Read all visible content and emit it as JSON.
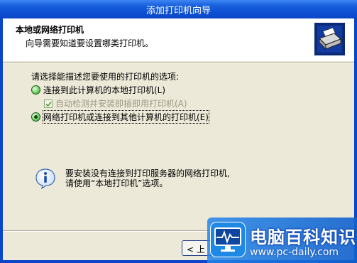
{
  "window": {
    "title": "添加打印机向导",
    "colors": {
      "titlebar": "#0c4fd3",
      "client": "#ece9d8",
      "accent": "#1d8fe6"
    }
  },
  "header": {
    "title": "本地或网络打印机",
    "subtitle": "向导需要知道要设置哪类打印机。",
    "icon": "printer-icon"
  },
  "content": {
    "prompt": "请选择能描述您要使用的打印机的选项:",
    "options": [
      {
        "label": "连接到此计算机的本地打印机(L)",
        "selected": false
      },
      {
        "label": "网络打印机或连接到其他计算机的打印机(E)",
        "selected": true
      }
    ],
    "auto_detect": {
      "label": "自动检测并安装即插即用打印机(A)",
      "checked": true,
      "disabled": true
    },
    "info": {
      "icon": "info-icon",
      "line1": "要安装没有连接到打印服务器的网络打印机,",
      "line2": "请使用“本地打印机”选项。"
    }
  },
  "footer": {
    "back_label": "< 上一"
  },
  "watermark": {
    "brand": "电脑百科知识",
    "url": "www.pc-daily.com"
  }
}
